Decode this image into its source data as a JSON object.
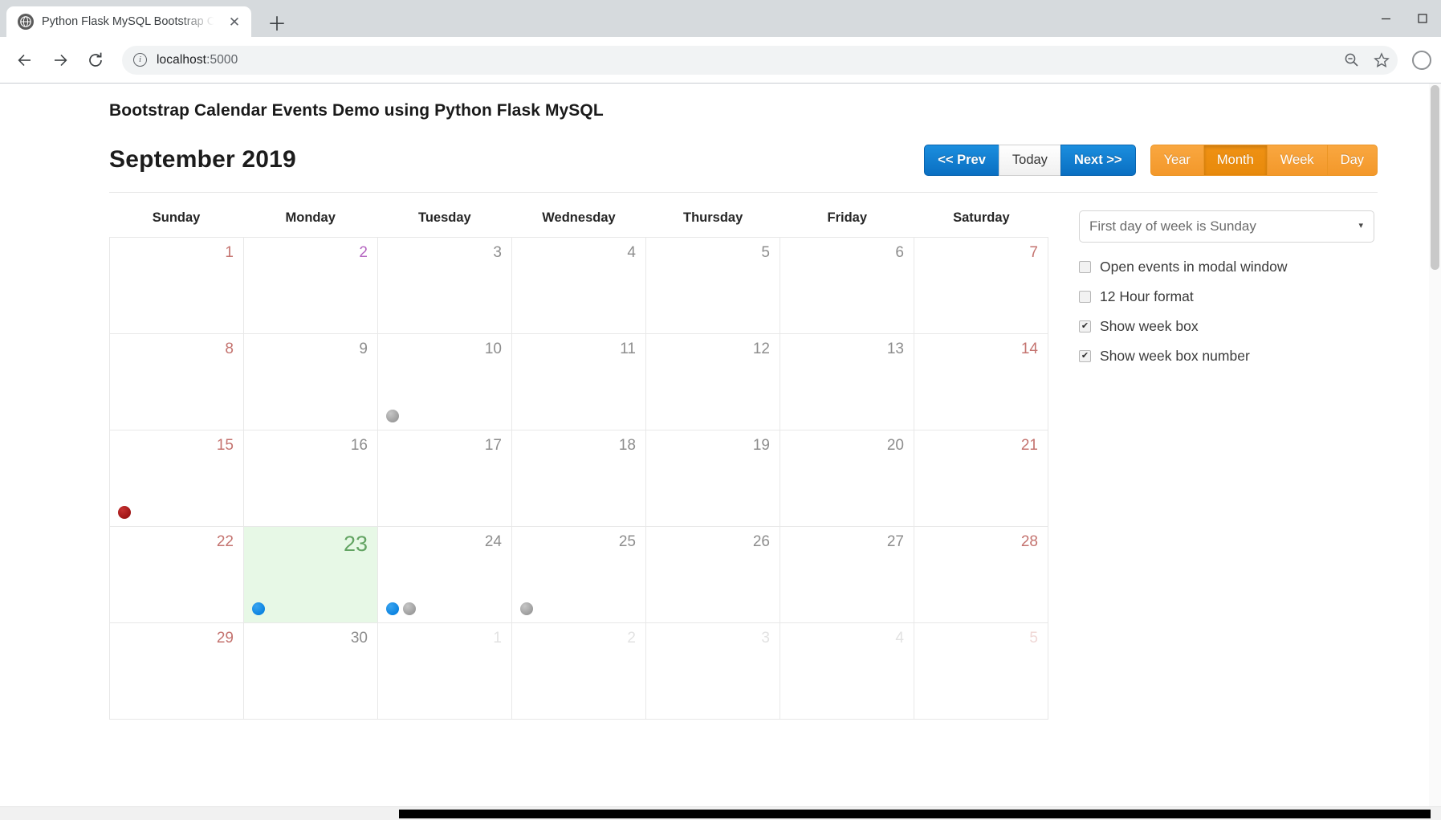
{
  "browser": {
    "tab": {
      "title": "Python Flask MySQL Bootstrap C",
      "close_label": "✕",
      "favicon_name": "globe-icon"
    },
    "newtab_label": "＋",
    "window_controls": {
      "minimize": "─",
      "maximize": "☐",
      "close": "✕"
    },
    "nav": {
      "back": "←",
      "forward": "→",
      "reload": "↻"
    },
    "omnibox": {
      "url_host": "localhost",
      "url_port": ":5000",
      "full_url": "localhost:5000",
      "info_icon": "i",
      "zoom_icon": "zoom-out-icon",
      "bookmark_icon": "star-icon",
      "profile_icon": "profile-icon"
    }
  },
  "page": {
    "heading": "Bootstrap Calendar Events Demo using Python Flask MySQL",
    "month_title": "September 2019"
  },
  "toolbar": {
    "nav_group": [
      {
        "label": "<< Prev",
        "style": "blue",
        "name": "prev-button"
      },
      {
        "label": "Today",
        "style": "white",
        "name": "today-button"
      },
      {
        "label": "Next >>",
        "style": "blue",
        "name": "next-button"
      }
    ],
    "view_group": [
      {
        "label": "Year",
        "active": false,
        "name": "view-year-button"
      },
      {
        "label": "Month",
        "active": true,
        "name": "view-month-button"
      },
      {
        "label": "Week",
        "active": false,
        "name": "view-week-button"
      },
      {
        "label": "Day",
        "active": false,
        "name": "view-day-button"
      }
    ]
  },
  "calendar": {
    "day_headers": [
      "Sunday",
      "Monday",
      "Tuesday",
      "Wednesday",
      "Thursday",
      "Friday",
      "Saturday"
    ],
    "weeks": [
      [
        {
          "day": "1",
          "cls": "weekend"
        },
        {
          "day": "2",
          "cls": "visited"
        },
        {
          "day": "3",
          "cls": ""
        },
        {
          "day": "4",
          "cls": ""
        },
        {
          "day": "5",
          "cls": ""
        },
        {
          "day": "6",
          "cls": ""
        },
        {
          "day": "7",
          "cls": "weekend"
        }
      ],
      [
        {
          "day": "8",
          "cls": "weekend"
        },
        {
          "day": "9",
          "cls": ""
        },
        {
          "day": "10",
          "cls": "",
          "events": [
            "gray"
          ]
        },
        {
          "day": "11",
          "cls": ""
        },
        {
          "day": "12",
          "cls": ""
        },
        {
          "day": "13",
          "cls": ""
        },
        {
          "day": "14",
          "cls": "weekend"
        }
      ],
      [
        {
          "day": "15",
          "cls": "weekend",
          "events": [
            "red"
          ]
        },
        {
          "day": "16",
          "cls": ""
        },
        {
          "day": "17",
          "cls": ""
        },
        {
          "day": "18",
          "cls": ""
        },
        {
          "day": "19",
          "cls": ""
        },
        {
          "day": "20",
          "cls": ""
        },
        {
          "day": "21",
          "cls": "weekend"
        }
      ],
      [
        {
          "day": "22",
          "cls": "weekend"
        },
        {
          "day": "23",
          "cls": "today",
          "events": [
            "blue"
          ]
        },
        {
          "day": "24",
          "cls": "",
          "events": [
            "blue",
            "gray"
          ]
        },
        {
          "day": "25",
          "cls": "",
          "events": [
            "gray"
          ]
        },
        {
          "day": "26",
          "cls": ""
        },
        {
          "day": "27",
          "cls": ""
        },
        {
          "day": "28",
          "cls": "weekend"
        }
      ],
      [
        {
          "day": "29",
          "cls": "weekend"
        },
        {
          "day": "30",
          "cls": ""
        },
        {
          "day": "1",
          "cls": "other"
        },
        {
          "day": "2",
          "cls": "other"
        },
        {
          "day": "3",
          "cls": "other"
        },
        {
          "day": "4",
          "cls": "other"
        },
        {
          "day": "5",
          "cls": "other weekend"
        }
      ]
    ]
  },
  "sidebar": {
    "first_day_select": {
      "selected": "First day of week is Sunday",
      "arrow": "▾"
    },
    "options": [
      {
        "label": "Open events in modal window",
        "checked": false,
        "name": "option-open-events-modal"
      },
      {
        "label": "12 Hour format",
        "checked": false,
        "name": "option-12-hour-format"
      },
      {
        "label": "Show week box",
        "checked": true,
        "name": "option-show-week-box"
      },
      {
        "label": "Show week box number",
        "checked": true,
        "name": "option-show-week-box-number"
      }
    ]
  },
  "colors": {
    "accent_blue": "#0a6fc2",
    "accent_orange": "#f3982a",
    "today_bg": "#e7f8e6",
    "today_text": "#63a463",
    "weekend_text": "#c4736f",
    "event_gray": "#9a9a9a",
    "event_blue": "#0a82e0",
    "event_red": "#9c1414"
  }
}
